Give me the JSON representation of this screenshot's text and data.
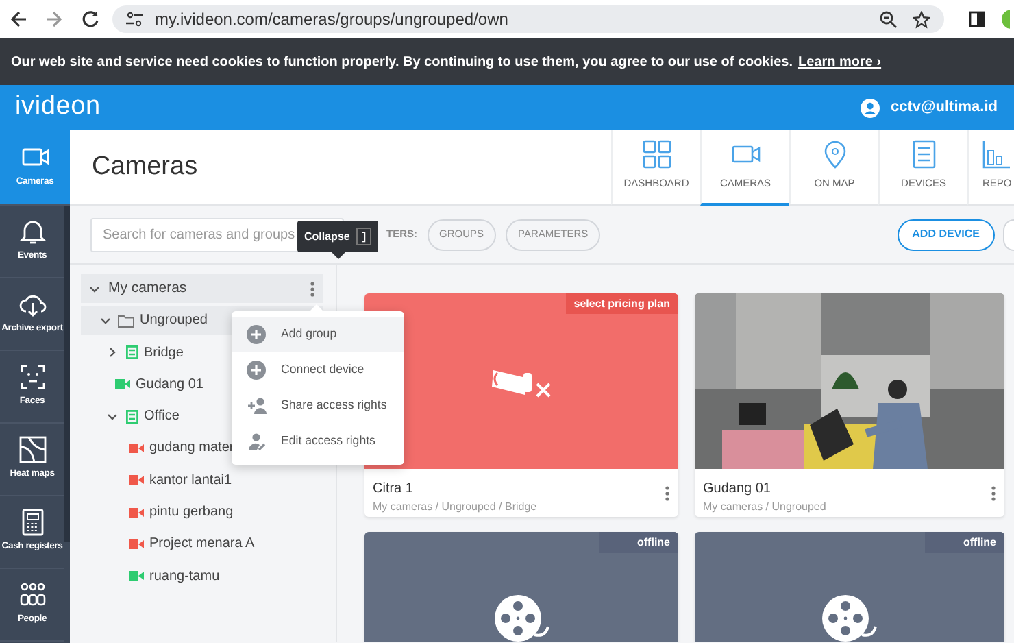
{
  "browser": {
    "url": "my.ivideon.com/cameras/groups/ungrouped/own"
  },
  "cookie_banner": {
    "text": "Our web site and service need cookies to function properly. By continuing to use them, you agree to our use of cookies.",
    "link": "Learn more ›"
  },
  "header": {
    "logo": "ivideon",
    "user": "cctv@ultima.id"
  },
  "nav": [
    {
      "label": "Cameras",
      "selected": true
    },
    {
      "label": "Events",
      "selected": false
    },
    {
      "label": "Archive export",
      "selected": false
    },
    {
      "label": "Faces",
      "selected": false
    },
    {
      "label": "Heat maps",
      "selected": false
    },
    {
      "label": "Cash registers",
      "selected": false
    },
    {
      "label": "People",
      "selected": false
    }
  ],
  "page_title": "Cameras",
  "tabs": [
    {
      "label": "DASHBOARD",
      "selected": false
    },
    {
      "label": "CAMERAS",
      "selected": true
    },
    {
      "label": "ON MAP",
      "selected": false
    },
    {
      "label": "DEVICES",
      "selected": false
    },
    {
      "label": "REPO",
      "selected": false
    }
  ],
  "toolbar": {
    "search_placeholder": "Search for cameras and groups",
    "tooltip": "Collapse",
    "tooltip_key": "]",
    "filters_label": "TERS:",
    "filters": [
      "GROUPS",
      "PARAMETERS"
    ],
    "add_button": "ADD DEVICE"
  },
  "tree": [
    {
      "label": "My cameras",
      "kind": "root",
      "expanded": true,
      "children": [
        {
          "label": "Ungrouped",
          "kind": "folder",
          "expanded": true,
          "children": [
            {
              "label": "Bridge",
              "kind": "group",
              "expanded": false
            },
            {
              "label": "Gudang 01",
              "kind": "camera",
              "color": "#2ecc71"
            },
            {
              "label": "Office",
              "kind": "group",
              "expanded": true,
              "children": [
                {
                  "label": "gudang mater",
                  "kind": "camera",
                  "color": "#f0584a"
                },
                {
                  "label": "kantor lantai1",
                  "kind": "camera",
                  "color": "#f0584a"
                },
                {
                  "label": "pintu gerbang",
                  "kind": "camera",
                  "color": "#f0584a"
                },
                {
                  "label": "Project menara A",
                  "kind": "camera",
                  "color": "#f0584a"
                },
                {
                  "label": "ruang-tamu",
                  "kind": "camera",
                  "color": "#2ecc71"
                }
              ]
            }
          ]
        }
      ]
    }
  ],
  "context_menu": [
    {
      "label": "Add group",
      "kind": "add",
      "selected": true
    },
    {
      "label": "Connect device",
      "kind": "add",
      "selected": false
    },
    {
      "label": "Share access rights",
      "kind": "share",
      "selected": false
    },
    {
      "label": "Edit access rights",
      "kind": "edit",
      "selected": false
    }
  ],
  "cameras": [
    {
      "kind": "no_plan",
      "badge": "select pricing plan",
      "title": "Citra 1",
      "path": "My cameras / Ungrouped / Bridge"
    },
    {
      "kind": "picture",
      "title": "Gudang 01",
      "path": "My cameras / Ungrouped"
    },
    {
      "kind": "offline",
      "badge": "offline"
    },
    {
      "kind": "offline",
      "badge": "offline"
    }
  ]
}
